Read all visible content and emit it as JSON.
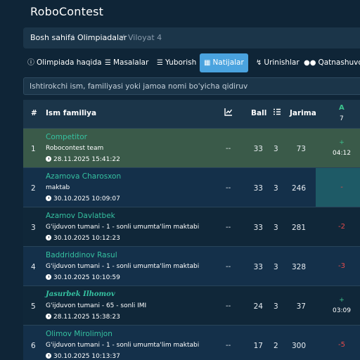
{
  "app": {
    "title": "RoboContest"
  },
  "breadcrumb": {
    "home": "Bosh sahifa",
    "sep": "/",
    "olympiads": "Olimpiadalar",
    "current": "Viloyat 4"
  },
  "tabs": [
    {
      "label": "Olimpiada haqida",
      "icon": "info-icon"
    },
    {
      "label": "Masalalar",
      "icon": "list-icon"
    },
    {
      "label": "Yuborish",
      "icon": "list-check-icon"
    },
    {
      "label": "Natijalar",
      "icon": "table-icon",
      "active": true
    },
    {
      "label": "Urinishlar",
      "icon": "bolt-icon"
    },
    {
      "label": "Qatnashuvchilar",
      "icon": "users-icon"
    }
  ],
  "search": {
    "placeholder": "Ishtirokchi ism, familiyasi yoki jamoa nomi bo'yicha qidiruv"
  },
  "table": {
    "headers": {
      "rank": "#",
      "name": "Ism familiya",
      "ball": "Ball",
      "jarima": "Jarima",
      "problem_letter": "A",
      "problem_count": "7"
    },
    "rows": [
      {
        "rank": "1",
        "name": "Competitor",
        "team": "Robocontest team",
        "time": "28.11.2025 15:41:22",
        "trend": "--",
        "ball": "33",
        "count": "3",
        "penalty": "73",
        "a_top": "+",
        "a_bottom": "04:12"
      },
      {
        "rank": "2",
        "name": "Azamova Charosxon",
        "team": "maktab",
        "time": "30.10.2025 10:09:07",
        "trend": "--",
        "ball": "33",
        "count": "3",
        "penalty": "246",
        "a_single": "-"
      },
      {
        "rank": "3",
        "name": "Azamov Davlatbek",
        "team": "G'ijduvon tumani - 1 - sonli umumta'lim maktabi",
        "time": "30.10.2025 10:12:23",
        "trend": "--",
        "ball": "33",
        "count": "3",
        "penalty": "281",
        "a_single": "-2"
      },
      {
        "rank": "4",
        "name": "Baddriddinov Rasul",
        "team": "G'ijduvon tumani - 1 - sonli umumta'lim maktabi",
        "time": "30.10.2025 10:10:59",
        "trend": "--",
        "ball": "33",
        "count": "3",
        "penalty": "328",
        "a_single": "-3"
      },
      {
        "rank": "5",
        "name": "Jasurbek Ilhomov",
        "team": "G'ijduvon tumani - 65 - sonli IMI",
        "time": "28.11.2025 15:38:23",
        "trend": "--",
        "ball": "24",
        "count": "3",
        "penalty": "37",
        "a_top": "+",
        "a_bottom": "03:09"
      },
      {
        "rank": "6",
        "name": "Olimov Mirolimjon",
        "team": "G'ijduvon tumani - 1 - sonli umumta'lim maktabi",
        "time": "30.10.2025 10:13:37",
        "trend": "--",
        "ball": "17",
        "count": "2",
        "penalty": "300",
        "a_single": "-5"
      }
    ]
  },
  "colors": {
    "background": "#0f2537",
    "panel": "#1b3549",
    "accent": "#4aa3df",
    "name": "#35c1a0",
    "highlight_row": "#3a5a49",
    "solved": "#3cc38d",
    "failed": "#e54b4b"
  }
}
